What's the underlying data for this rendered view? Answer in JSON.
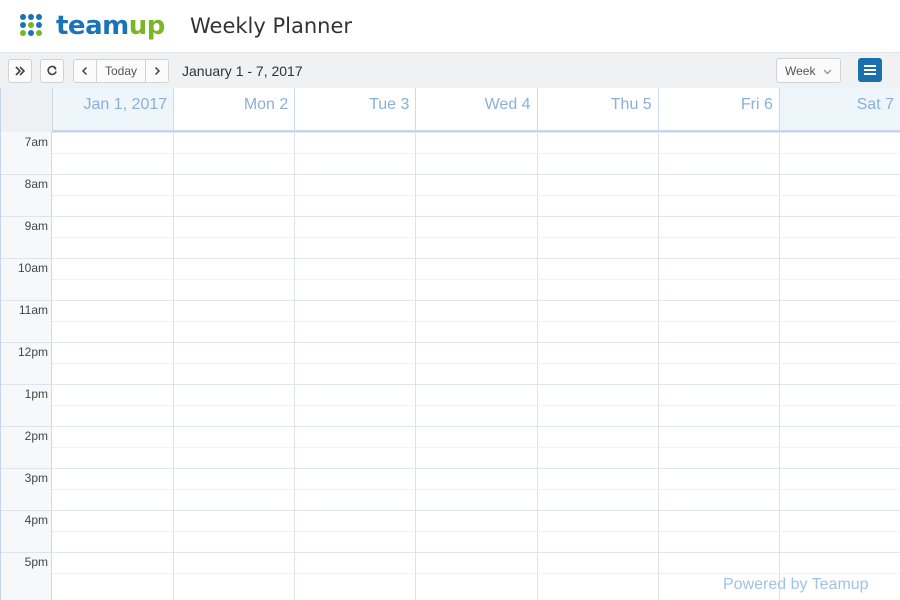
{
  "app": {
    "logo_text_primary": "team",
    "logo_text_secondary": "up",
    "title": "Weekly Planner",
    "brand_blue": "#1a74b8",
    "brand_green": "#7ab628"
  },
  "toolbar": {
    "expand_icon": "double-chevron-right-icon",
    "refresh_icon": "refresh-icon",
    "prev_icon": "chevron-left-icon",
    "today_label": "Today",
    "next_icon": "chevron-right-icon",
    "date_range": "January 1 - 7, 2017",
    "view_selected": "Week",
    "menu_icon": "hamburger-menu-icon",
    "menu_color": "#1b6fad"
  },
  "calendar": {
    "days": [
      {
        "label": "Jan 1, 2017",
        "weekend": true
      },
      {
        "label": "Mon 2",
        "weekend": false
      },
      {
        "label": "Tue 3",
        "weekend": false
      },
      {
        "label": "Wed 4",
        "weekend": false
      },
      {
        "label": "Thu 5",
        "weekend": false
      },
      {
        "label": "Fri 6",
        "weekend": false
      },
      {
        "label": "Sat 7",
        "weekend": true
      }
    ],
    "hours": [
      "7am",
      "8am",
      "9am",
      "10am",
      "11am",
      "12pm",
      "1pm",
      "2pm",
      "3pm",
      "4pm",
      "5pm"
    ],
    "header_text_color": "#8ab0d9"
  },
  "footer": {
    "powered_by": "Powered by Teamup"
  }
}
